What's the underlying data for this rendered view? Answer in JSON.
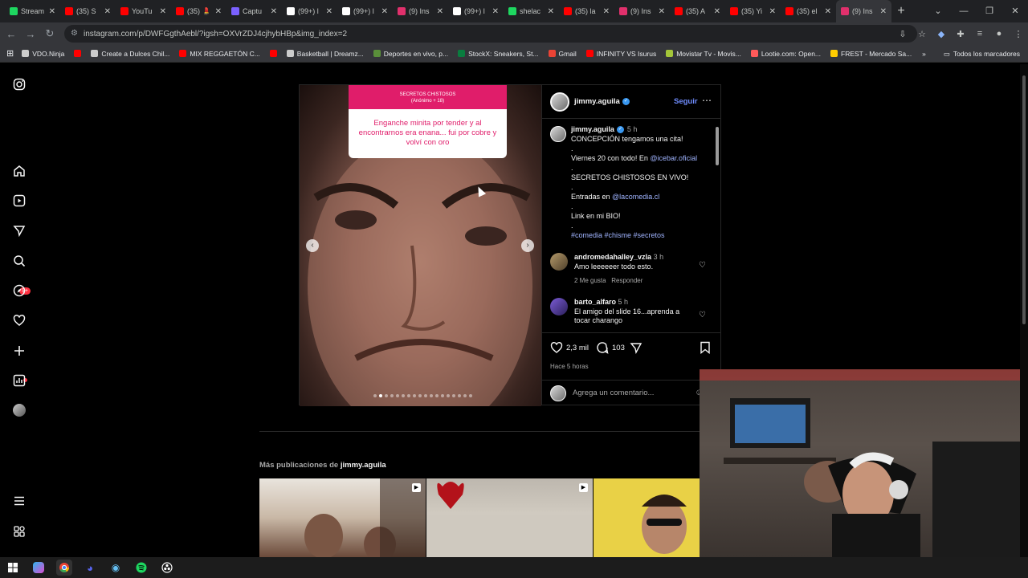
{
  "browser": {
    "tabs": [
      {
        "title": "Stream",
        "color": "#1ed760"
      },
      {
        "title": "(35) S",
        "color": "#ff0000"
      },
      {
        "title": "YouTu",
        "color": "#ff0000"
      },
      {
        "title": "(35) 💄",
        "color": "#ff0000"
      },
      {
        "title": "Captu",
        "color": "#7b61ff"
      },
      {
        "title": "(99+) l",
        "color": "#ffffff"
      },
      {
        "title": "(99+) l",
        "color": "#ffffff"
      },
      {
        "title": "(9) Ins",
        "color": "#e1306c"
      },
      {
        "title": "(99+) l",
        "color": "#ffffff"
      },
      {
        "title": "shelac",
        "color": "#1ed760"
      },
      {
        "title": "(35) la",
        "color": "#ff0000"
      },
      {
        "title": "(9) Ins",
        "color": "#e1306c"
      },
      {
        "title": "(35) A",
        "color": "#ff0000"
      },
      {
        "title": "(35) Yi",
        "color": "#ff0000"
      },
      {
        "title": "(35) el",
        "color": "#ff0000"
      },
      {
        "title": "(9) Ins",
        "color": "#e1306c"
      }
    ],
    "url": "instagram.com/p/DWFGgthAebl/?igsh=OXVrZDJ4cjhybHBp&img_index=2",
    "bookmarks": [
      {
        "label": "VDO.Ninja",
        "color": "#cccccc"
      },
      {
        "label": "",
        "color": "#ff0000"
      },
      {
        "label": "Create a Dulces Chil...",
        "color": "#cccccc"
      },
      {
        "label": "MIX REGGAETÓN C...",
        "color": "#ff0000"
      },
      {
        "label": "",
        "color": "#ff0000"
      },
      {
        "label": "Basketball | Dreamz...",
        "color": "#cccccc"
      },
      {
        "label": "Deportes en vivo, p...",
        "color": "#5a8f3a"
      },
      {
        "label": "StockX: Sneakers, St...",
        "color": "#0a7d3f"
      },
      {
        "label": "Gmail",
        "color": "#ea4335"
      },
      {
        "label": "INFINITY VS Isurus",
        "color": "#ff0000"
      },
      {
        "label": "Movistar Tv - Movis...",
        "color": "#a4c639"
      },
      {
        "label": "Lootie.com: Open...",
        "color": "#ff5a5a"
      },
      {
        "label": "FREST - Mercado Sa...",
        "color": "#ffcc00"
      }
    ],
    "bookmarks_folder": "Todos los marcadores"
  },
  "post": {
    "username": "jimmy.aguila",
    "follow_label": "Seguir",
    "question_header": "SECRETOS CHISTOSOS\n(Anónimo + 18)",
    "question_text": "Enganche minita por tender y al encontrarnos era enana... fui por cobre y volví con oro",
    "caption": {
      "username": "jimmy.aguila",
      "time": "5 h",
      "line1": "CONCEPCIÓN tengamos una cita!",
      "dot": ".",
      "line2_pre": "Viernes 20 con todo! En ",
      "line2_link": "@icebar.oficial",
      "line3": "SECRETOS CHISTOSOS EN VIVO!",
      "line4_pre": "Entradas en ",
      "line4_link": "@lacomedia.cl",
      "line5": "Link en mi BIO!",
      "hashtags": "#comedia #chisme #secretos"
    },
    "comments": [
      {
        "user": "andromedahalley_vzla",
        "time": "3 h",
        "text": "Amo leeeeeer todo esto.",
        "likes": "2 Me gusta",
        "reply": "Responder"
      },
      {
        "user": "barto_alfaro",
        "time": "5 h",
        "text": "El amigo del slide 16...aprenda a tocar charango"
      }
    ],
    "likes": "2,3 mil",
    "comment_count": "103",
    "posted_ago": "Hace 5 horas",
    "add_comment_placeholder": "Agrega un comentario..."
  },
  "more_posts": {
    "prefix": "Más publicaciones de ",
    "username": "jimmy.aguila"
  },
  "sidebar_badge": "9+"
}
